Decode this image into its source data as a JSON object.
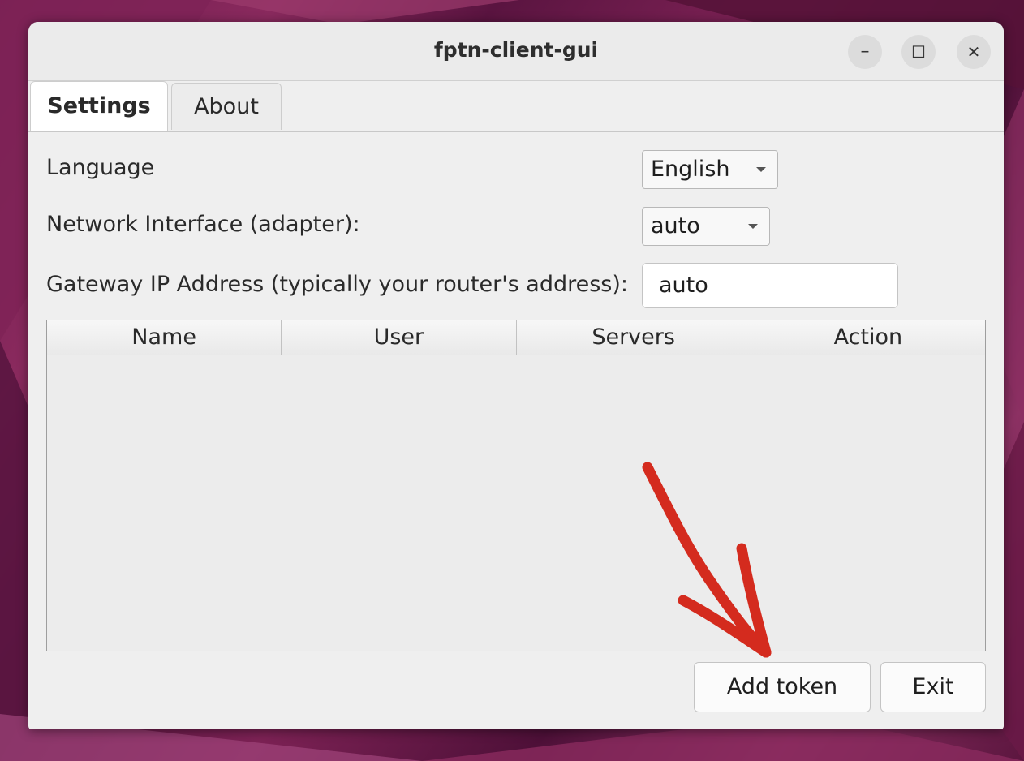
{
  "window": {
    "title": "fptn-client-gui",
    "controls": {
      "minimize": "–",
      "maximize": "☐",
      "close": "✕"
    }
  },
  "tabs": [
    {
      "label": "Settings",
      "active": true
    },
    {
      "label": "About",
      "active": false
    }
  ],
  "settings": {
    "language_label": "Language",
    "language_value": "English",
    "interface_label": "Network Interface (adapter):",
    "interface_value": "auto",
    "gateway_label": "Gateway IP Address (typically your router's address):",
    "gateway_value": "auto"
  },
  "table": {
    "columns": [
      "Name",
      "User",
      "Servers",
      "Action"
    ],
    "rows": []
  },
  "buttons": {
    "add_token": "Add token",
    "exit": "Exit"
  },
  "annotation": {
    "type": "hand-drawn arrow",
    "color": "#d42b1e",
    "points_to": "Add token"
  }
}
